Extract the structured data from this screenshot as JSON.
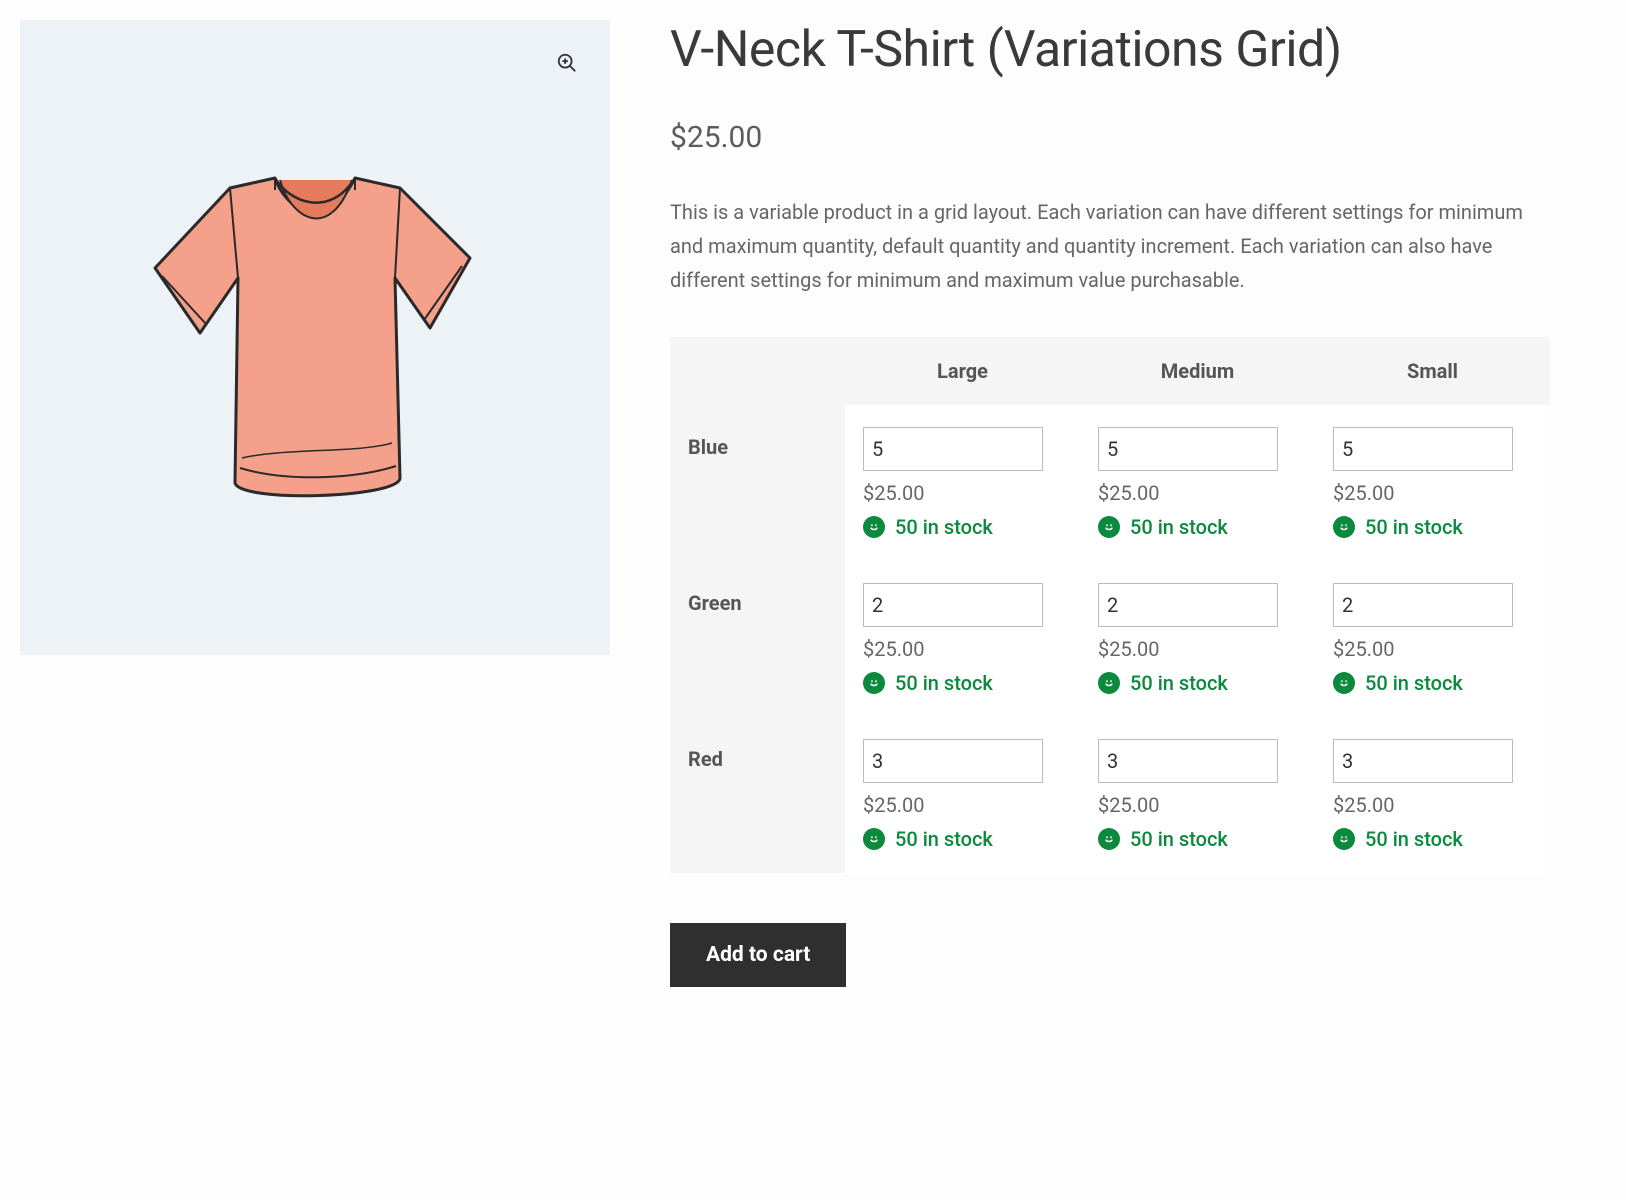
{
  "product": {
    "title": "V-Neck T-Shirt (Variations Grid)",
    "price": "$25.00",
    "description": "This is a variable product in a grid layout. Each variation can have different settings for minimum and maximum quantity, default quantity and quantity increment. Each variation can also have different settings for minimum and maximum value purchasable.",
    "add_to_cart_label": "Add to cart"
  },
  "grid": {
    "columns": [
      "Large",
      "Medium",
      "Small"
    ],
    "rows": [
      {
        "label": "Blue",
        "cells": [
          {
            "qty": "5",
            "price": "$25.00",
            "stock": "50 in stock"
          },
          {
            "qty": "5",
            "price": "$25.00",
            "stock": "50 in stock"
          },
          {
            "qty": "5",
            "price": "$25.00",
            "stock": "50 in stock"
          }
        ]
      },
      {
        "label": "Green",
        "cells": [
          {
            "qty": "2",
            "price": "$25.00",
            "stock": "50 in stock"
          },
          {
            "qty": "2",
            "price": "$25.00",
            "stock": "50 in stock"
          },
          {
            "qty": "2",
            "price": "$25.00",
            "stock": "50 in stock"
          }
        ]
      },
      {
        "label": "Red",
        "cells": [
          {
            "qty": "3",
            "price": "$25.00",
            "stock": "50 in stock"
          },
          {
            "qty": "3",
            "price": "$25.00",
            "stock": "50 in stock"
          },
          {
            "qty": "3",
            "price": "$25.00",
            "stock": "50 in stock"
          }
        ]
      }
    ]
  }
}
